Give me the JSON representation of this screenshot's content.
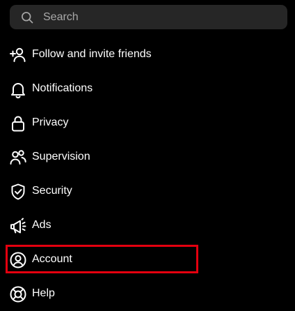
{
  "search": {
    "placeholder": "Search",
    "icon": "search-icon"
  },
  "menu": {
    "items": [
      {
        "id": "follow-invite",
        "label": "Follow and invite friends",
        "icon": "add-person-icon"
      },
      {
        "id": "notifications",
        "label": "Notifications",
        "icon": "bell-icon"
      },
      {
        "id": "privacy",
        "label": "Privacy",
        "icon": "lock-icon"
      },
      {
        "id": "supervision",
        "label": "Supervision",
        "icon": "people-icon"
      },
      {
        "id": "security",
        "label": "Security",
        "icon": "shield-check-icon"
      },
      {
        "id": "ads",
        "label": "Ads",
        "icon": "megaphone-icon"
      },
      {
        "id": "account",
        "label": "Account",
        "icon": "user-circle-icon",
        "highlighted": true
      },
      {
        "id": "help",
        "label": "Help",
        "icon": "lifebuoy-icon"
      }
    ]
  },
  "colors": {
    "background": "#000000",
    "search_background": "#262626",
    "placeholder": "#a8a8a8",
    "text": "#ffffff",
    "highlight": "#e4000f"
  }
}
